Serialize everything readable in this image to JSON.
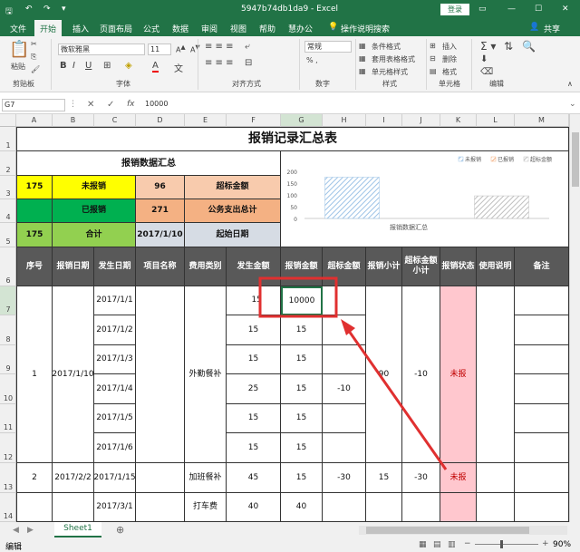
{
  "app": {
    "title": "5947b74db1da9  -  Excel",
    "login": "登录",
    "share": "共享"
  },
  "tabs": [
    "文件",
    "开始",
    "插入",
    "页面布局",
    "公式",
    "数据",
    "审阅",
    "视图",
    "帮助",
    "慧办公",
    "操作说明搜索"
  ],
  "ribbon": {
    "font_name": "微软雅黑",
    "font_size": "11",
    "number_format": "常规",
    "groups": [
      "剪贴板",
      "字体",
      "对齐方式",
      "数字",
      "样式",
      "单元格",
      "编辑"
    ],
    "paste": "粘贴",
    "styles": [
      "条件格式",
      "套用表格格式",
      "单元格样式"
    ],
    "cells": [
      "插入",
      "删除",
      "格式"
    ]
  },
  "formula_bar": {
    "cell_ref": "G7",
    "fx": "fx",
    "value": "10000"
  },
  "columns": [
    "A",
    "B",
    "C",
    "D",
    "E",
    "F",
    "G",
    "H",
    "I",
    "J",
    "K",
    "L",
    "M"
  ],
  "rows": [
    "1",
    "2",
    "3",
    "4",
    "5",
    "6",
    "7",
    "8",
    "9",
    "10",
    "11",
    "12",
    "13",
    "14"
  ],
  "sheet": {
    "title": "报销记录汇总表",
    "summary_title": "报销数据汇总",
    "summary": [
      {
        "a": "175",
        "b": "未报销",
        "c": "96",
        "d": "超标金额"
      },
      {
        "a": "",
        "b": "已报销",
        "c": "271",
        "d": "公务支出总计"
      },
      {
        "a": "175",
        "b": "合计",
        "c": "2017/1/10",
        "d": "起始日期"
      }
    ],
    "headers": [
      "序号",
      "报销日期",
      "发生日期",
      "项目名称",
      "费用类别",
      "发生金额",
      "报销金额",
      "超标金额",
      "报销小计",
      "超标金额小计",
      "报销状态",
      "使用说明",
      "备注"
    ],
    "group1": {
      "seq": "1",
      "date": "2017/1/10",
      "category": "外勤餐补",
      "subtotal": "90",
      "over_subtotal": "-10",
      "status": "未报"
    },
    "rows": [
      {
        "date": "2017/1/1",
        "amt": "15",
        "reimb": "10000",
        "over": ""
      },
      {
        "date": "2017/1/2",
        "amt": "15",
        "reimb": "15",
        "over": ""
      },
      {
        "date": "2017/1/3",
        "amt": "15",
        "reimb": "15",
        "over": ""
      },
      {
        "date": "2017/1/4",
        "amt": "25",
        "reimb": "15",
        "over": "-10"
      },
      {
        "date": "2017/1/5",
        "amt": "15",
        "reimb": "15",
        "over": ""
      },
      {
        "date": "2017/1/6",
        "amt": "15",
        "reimb": "15",
        "over": ""
      }
    ],
    "row13": {
      "seq": "2",
      "rdate": "2017/2/2",
      "date": "2017/1/15",
      "category": "加班餐补",
      "amt": "45",
      "reimb": "15",
      "over": "-30",
      "subtotal": "15",
      "over_subtotal": "-30",
      "status": "未报"
    },
    "row14": {
      "date": "2017/3/1",
      "category": "打车费",
      "amt": "40",
      "reimb": "40"
    }
  },
  "chart_data": {
    "type": "bar",
    "title": "",
    "xlabel": "报销数据汇总",
    "categories": [
      "报销数据汇总"
    ],
    "series": [
      {
        "name": "未报销",
        "values": [
          175
        ]
      },
      {
        "name": "已报销",
        "values": [
          0
        ]
      },
      {
        "name": "超标金额",
        "values": [
          96
        ]
      }
    ],
    "ylim": [
      0,
      200
    ],
    "yticks": [
      "0",
      "50",
      "100",
      "150",
      "200"
    ],
    "legend": "top-right",
    "colors": [
      "#9dc3e6",
      "#f4b183",
      "#bfbfbf"
    ]
  },
  "sheet_tab": "Sheet1",
  "status": {
    "mode": "编辑",
    "zoom": "90%"
  },
  "colors": {
    "excel_green": "#217346",
    "yellow": "#ffff00",
    "green": "#00b050",
    "light_green": "#92d050",
    "salmon": "#f8cbad",
    "tan": "#f4b183",
    "grey_blue": "#d6dce4",
    "header_grey": "#595959",
    "pink": "#ffc7ce",
    "highlight": "#e03030"
  }
}
